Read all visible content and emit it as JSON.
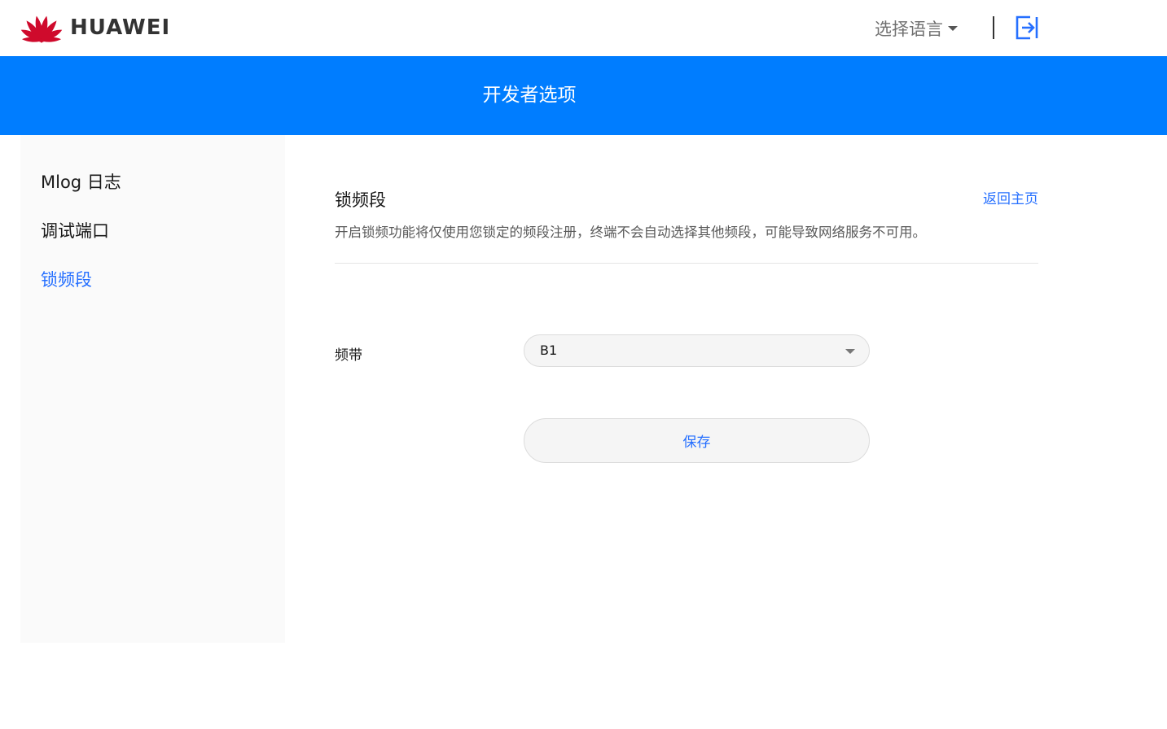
{
  "header": {
    "brand": "HUAWEI",
    "language_label": "选择语言",
    "brand_color": "#cf0a2c"
  },
  "banner": {
    "title": "开发者选项",
    "color": "#007dff"
  },
  "sidebar": {
    "items": [
      {
        "label": "Mlog 日志",
        "active": false
      },
      {
        "label": "调试端口",
        "active": false
      },
      {
        "label": "锁频段",
        "active": true
      }
    ]
  },
  "main": {
    "title": "锁频段",
    "back_link": "返回主页",
    "description": "开启锁频功能将仅使用您锁定的频段注册，终端不会自动选择其他频段，可能导致网络服务不可用。",
    "band_label": "频带",
    "band_value": "B1",
    "save_label": "保存",
    "accent_color": "#256fff"
  }
}
